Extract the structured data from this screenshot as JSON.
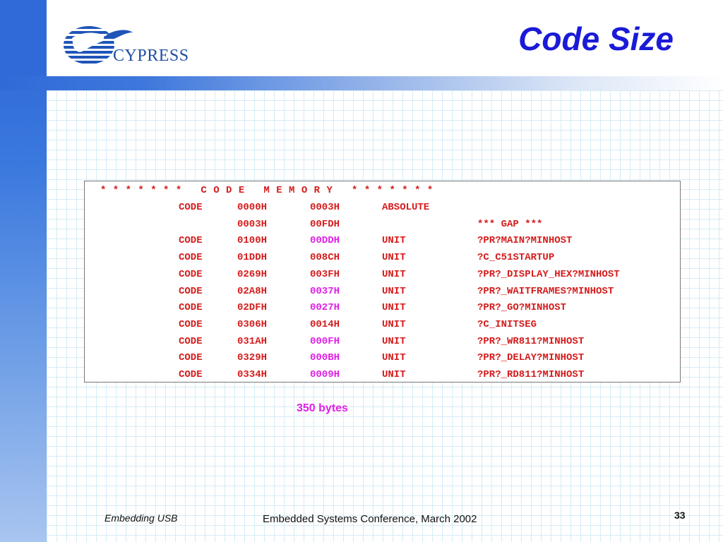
{
  "slide": {
    "title": "Code Size",
    "logo_text": "CYPRESS"
  },
  "memory": {
    "header": "* * * * * * *   C O D E   M E M O R Y   * * * * * * *",
    "rows": [
      {
        "type": "CODE",
        "base": "0000H",
        "length": "0003H",
        "relocation": "ABSOLUTE",
        "segment": "",
        "length_highlight": false
      },
      {
        "type": "",
        "base": "0003H",
        "length": "00FDH",
        "relocation": "",
        "segment": "*** GAP ***",
        "length_highlight": false
      },
      {
        "type": "CODE",
        "base": "0100H",
        "length": "00DDH",
        "relocation": "UNIT",
        "segment": "?PR?MAIN?MINHOST",
        "length_highlight": true
      },
      {
        "type": "CODE",
        "base": "01DDH",
        "length": "008CH",
        "relocation": "UNIT",
        "segment": "?C_C51STARTUP",
        "length_highlight": false
      },
      {
        "type": "CODE",
        "base": "0269H",
        "length": "003FH",
        "relocation": "UNIT",
        "segment": "?PR?_DISPLAY_HEX?MINHOST",
        "length_highlight": false
      },
      {
        "type": "CODE",
        "base": "02A8H",
        "length": "0037H",
        "relocation": "UNIT",
        "segment": "?PR?_WAITFRAMES?MINHOST",
        "length_highlight": true
      },
      {
        "type": "CODE",
        "base": "02DFH",
        "length": "0027H",
        "relocation": "UNIT",
        "segment": "?PR?_GO?MINHOST",
        "length_highlight": true
      },
      {
        "type": "CODE",
        "base": "0306H",
        "length": "0014H",
        "relocation": "UNIT",
        "segment": "?C_INITSEG",
        "length_highlight": false
      },
      {
        "type": "CODE",
        "base": "031AH",
        "length": "000FH",
        "relocation": "UNIT",
        "segment": "?PR?_WR811?MINHOST",
        "length_highlight": true
      },
      {
        "type": "CODE",
        "base": "0329H",
        "length": "000BH",
        "relocation": "UNIT",
        "segment": "?PR?_DELAY?MINHOST",
        "length_highlight": true
      },
      {
        "type": "CODE",
        "base": "0334H",
        "length": "0009H",
        "relocation": "UNIT",
        "segment": "?PR?_RD811?MINHOST",
        "length_highlight": true
      }
    ]
  },
  "summary": {
    "total": "350 bytes"
  },
  "footer": {
    "left": "Embedding USB",
    "center": "Embedded Systems Conference, March 2002",
    "page_number": "33"
  },
  "colors": {
    "title": "#1a1ad8",
    "code_text": "#d41c1c",
    "highlight": "#e020e8",
    "accent_blue": "#2f6ad8"
  }
}
